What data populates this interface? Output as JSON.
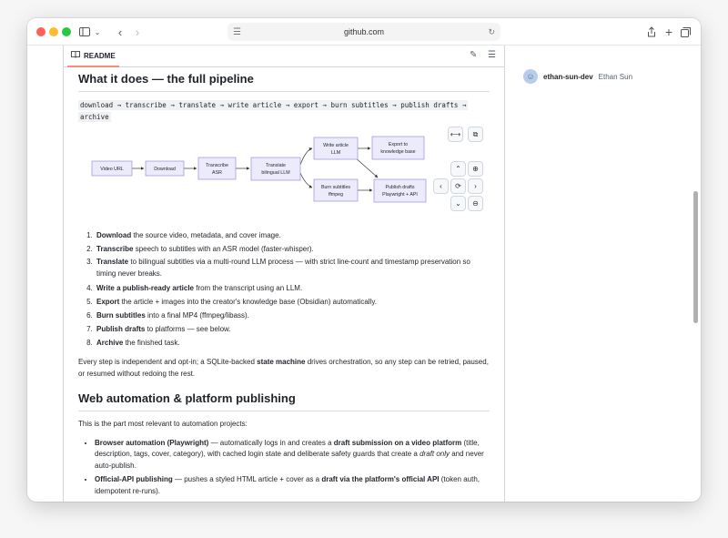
{
  "browser": {
    "url": "github.com"
  },
  "readme": {
    "tab_label": "README"
  },
  "sidebar": {
    "username": "ethan-sun-dev",
    "display_name": "Ethan Sun"
  },
  "section1": {
    "heading": "What it does — the full pipeline",
    "code_line1": "download → transcribe → translate → write article → export → burn subtitles → publish drafts →",
    "code_line2": "archive"
  },
  "diagram": {
    "nodes": {
      "video_url": "Video URL",
      "download": "Download",
      "transcribe_1": "Transcribe",
      "transcribe_2": "ASR",
      "translate_1": "Translate",
      "translate_2": "bilingual LLM",
      "write_1": "Write article",
      "write_2": "LLM",
      "export_1": "Export to",
      "export_2": "knowledge base",
      "burn_1": "Burn subtitles",
      "burn_2": "ffmpeg",
      "publish_1": "Publish drafts",
      "publish_2": "Playwright + API"
    }
  },
  "pipeline_steps": [
    {
      "bold": "Download",
      "rest": " the source video, metadata, and cover image."
    },
    {
      "bold": "Transcribe",
      "rest": " speech to subtitles with an ASR model (faster-whisper)."
    },
    {
      "bold": "Translate",
      "rest": " to bilingual subtitles via a multi-round LLM process — with strict line-count and timestamp preservation so timing never breaks."
    },
    {
      "bold": "Write a publish-ready article",
      "rest": " from the transcript using an LLM."
    },
    {
      "bold": "Export",
      "rest": " the article + images into the creator's knowledge base (Obsidian) automatically."
    },
    {
      "bold": "Burn subtitles",
      "rest": " into a final MP4 (ffmpeg/libass)."
    },
    {
      "bold": "Publish drafts",
      "rest": " to platforms — see below."
    },
    {
      "bold": "Archive",
      "rest": " the finished task."
    }
  ],
  "paragraph1": {
    "pre": "Every step is independent and opt-in; a SQLite-backed ",
    "bold": "state machine",
    "post": " drives orchestration, so any step can be retried, paused, or resumed without redoing the rest."
  },
  "section2": {
    "heading": "Web automation & platform publishing",
    "intro": "This is the part most relevant to automation projects:"
  },
  "bullets": {
    "b1_bold1": "Browser automation (Playwright)",
    "b1_text1": " — automatically logs in and creates a ",
    "b1_bold2": "draft submission on a video platform",
    "b1_text2": " (title, description, tags, cover, category), with cached login state and deliberate safety guards that create a ",
    "b1_em": "draft only",
    "b1_text3": " and never auto-publish.",
    "b2_bold1": "Official-API publishing",
    "b2_text1": " — pushes a styled HTML article + cover as a ",
    "b2_bold2": "draft via the platform's official API",
    "b2_text2": " (token auth, idempotent re-runs)."
  }
}
